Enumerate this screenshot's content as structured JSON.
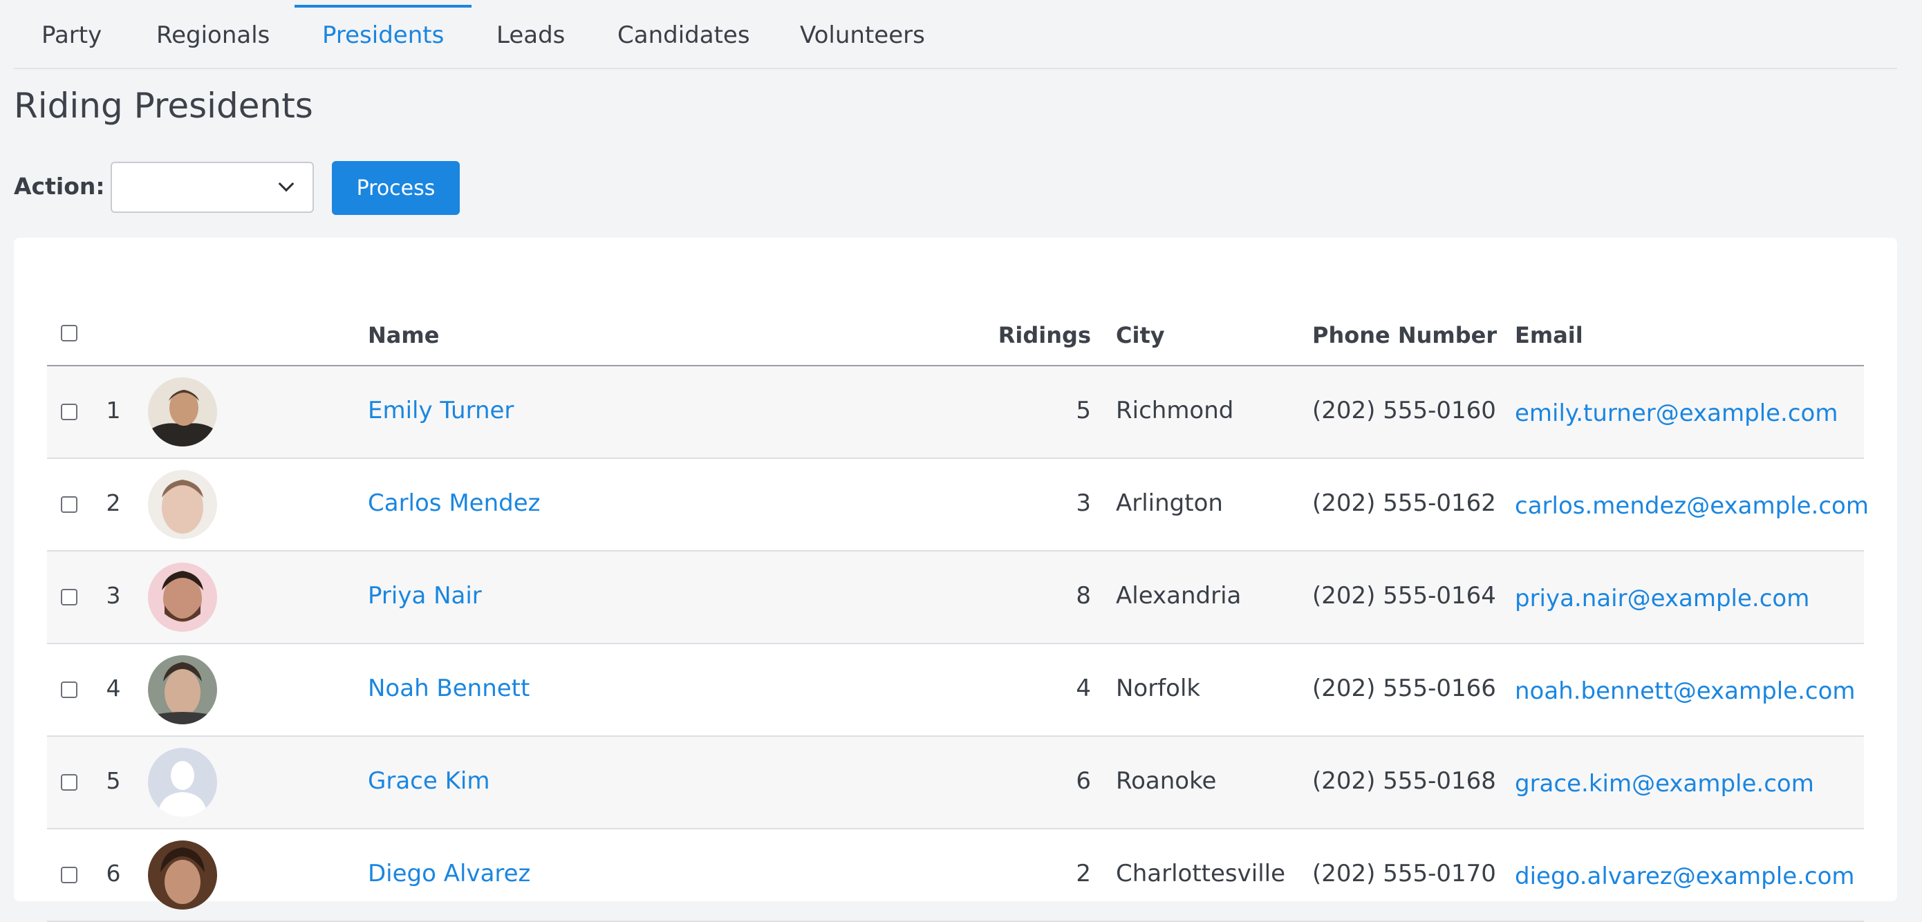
{
  "tabs": [
    {
      "label": "Party"
    },
    {
      "label": "Regionals"
    },
    {
      "label": "Presidents"
    },
    {
      "label": "Leads"
    },
    {
      "label": "Candidates"
    },
    {
      "label": "Volunteers"
    }
  ],
  "active_tab": "Presidents",
  "page_title": "Riding Presidents",
  "action": {
    "label": "Action:",
    "selected": "",
    "button": "Process"
  },
  "table": {
    "headers": {
      "name": "Name",
      "ridings": "Ridings",
      "city": "City",
      "phone": "Phone Number",
      "email": "Email"
    },
    "rows": [
      {
        "num": "1",
        "name": "Emily Turner",
        "ridings": "5",
        "city": "Richmond",
        "phone": "(202) 555-0160",
        "email": "emily.turner@example.com",
        "avatar": "photo-man-dark-jacket"
      },
      {
        "num": "2",
        "name": "Carlos Mendez",
        "ridings": "3",
        "city": "Arlington",
        "phone": "(202) 555-0162",
        "email": "carlos.mendez@example.com",
        "avatar": "photo-man-pale"
      },
      {
        "num": "3",
        "name": "Priya Nair",
        "ridings": "8",
        "city": "Alexandria",
        "phone": "(202) 555-0164",
        "email": "priya.nair@example.com",
        "avatar": "photo-man-beard-pink"
      },
      {
        "num": "4",
        "name": "Noah Bennett",
        "ridings": "4",
        "city": "Norfolk",
        "phone": "(202) 555-0166",
        "email": "noah.bennett@example.com",
        "avatar": "photo-man-green"
      },
      {
        "num": "5",
        "name": "Grace Kim",
        "ridings": "6",
        "city": "Roanoke",
        "phone": "(202) 555-0168",
        "email": "grace.kim@example.com",
        "avatar": "placeholder-silhouette"
      },
      {
        "num": "6",
        "name": "Diego Alvarez",
        "ridings": "2",
        "city": "Charlottesville",
        "phone": "(202) 555-0170",
        "email": "diego.alvarez@example.com",
        "avatar": "photo-man-curly-brown"
      }
    ]
  },
  "colors": {
    "accent": "#1a86e0",
    "background": "#f3f4f6",
    "text": "#3a3f47",
    "row_alt": "#f7f7f8"
  }
}
